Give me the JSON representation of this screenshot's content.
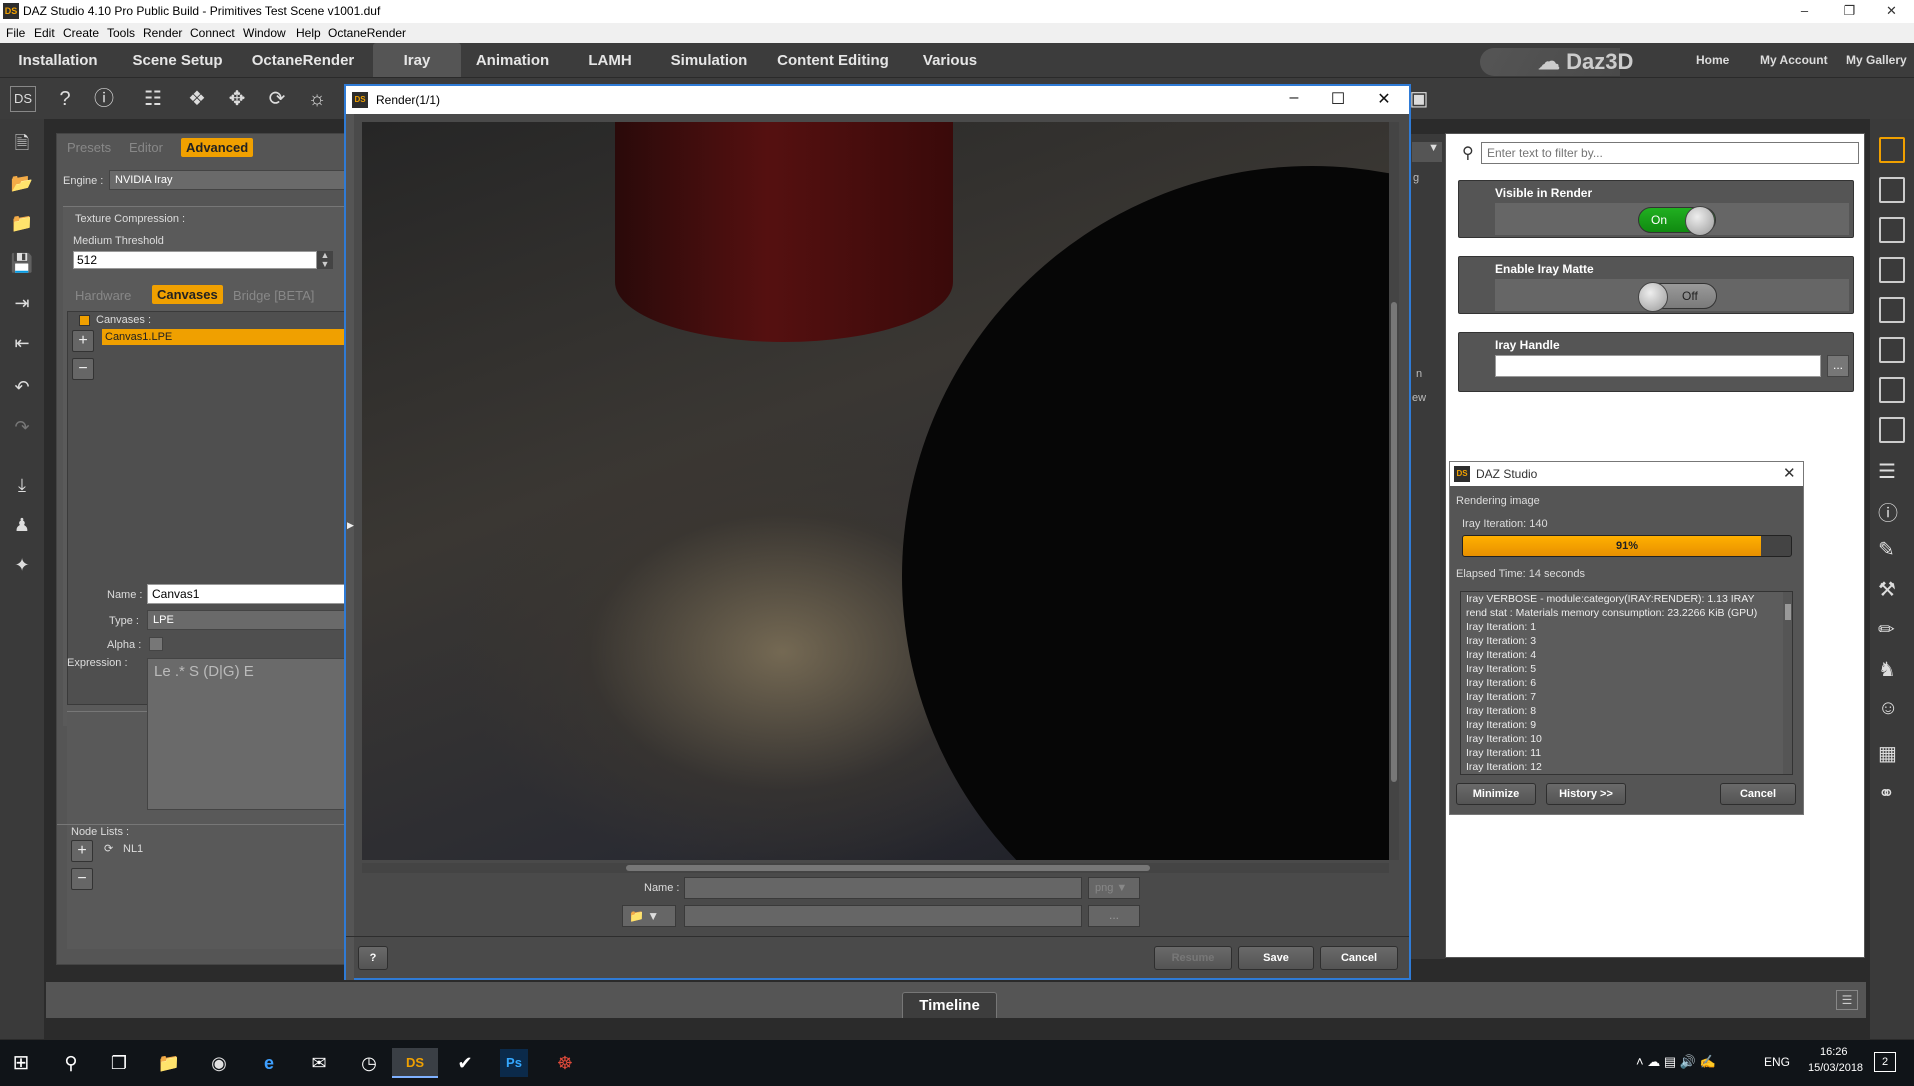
{
  "window": {
    "title": "DAZ Studio 4.10 Pro Public Build - Primitives Test Scene v1001.duf",
    "icon": "DS"
  },
  "menu": [
    "File",
    "Edit",
    "Create",
    "Tools",
    "Render",
    "Connect",
    "Window",
    "Help",
    "OctaneRender"
  ],
  "tabs": [
    "Installation",
    "Scene Setup",
    "OctaneRender",
    "Iray",
    "Animation",
    "LAMH",
    "Simulation",
    "Content Editing",
    "Various"
  ],
  "brand": {
    "name": "Daz3D",
    "links": [
      "Home",
      "My Account",
      "My Gallery"
    ]
  },
  "left_panel": {
    "tabs": [
      "Presets",
      "Editor",
      "Advanced"
    ],
    "engine_label": "Engine :",
    "engine_value": "NVIDIA Iray",
    "texture_compression": "Texture Compression :",
    "medium_threshold_label": "Medium Threshold",
    "medium_threshold_value": "512",
    "sub_tabs": [
      "Hardware",
      "Canvases",
      "Bridge [BETA]"
    ],
    "canvases_label": "Canvases :",
    "canvas_item": "Canvas1.LPE",
    "name_label": "Name :",
    "name_value": "Canvas1",
    "type_label": "Type :",
    "type_value": "LPE",
    "alpha_label": "Alpha :",
    "expression_label": "Expression :",
    "expression_value": "Le .* S (D|G) E",
    "node_lists_label": "Node Lists :",
    "node_list_item": "NL1"
  },
  "render_window": {
    "title": "Render(1/1)",
    "icon": "DS",
    "name_label": "Name :",
    "format_value": "png",
    "browse_label": "...",
    "buttons": {
      "help": "?",
      "resume": "Resume",
      "save": "Save",
      "cancel": "Cancel"
    }
  },
  "right_panel": {
    "search_placeholder": "Enter text to filter by...",
    "visible_in_render": {
      "label": "Visible in Render",
      "state": "On"
    },
    "enable_iray_matte": {
      "label": "Enable Iray Matte",
      "state": "Off"
    },
    "iray_handle": {
      "label": "Iray Handle",
      "button": "..."
    },
    "behind_fragments": [
      "g",
      "n",
      "ew"
    ]
  },
  "daz_dialog": {
    "title": "DAZ Studio",
    "icon": "DS",
    "status": "Rendering image",
    "iteration": "Iray Iteration: 140",
    "progress_percent": 91,
    "progress_label": "91%",
    "elapsed": "Elapsed Time:  14 seconds",
    "log": [
      "Iray VERBOSE - module:category(IRAY:RENDER):   1.13  IRAY",
      "rend stat : Materials memory consumption: 23.2266 KiB (GPU)",
      "Iray Iteration: 1",
      "Iray Iteration: 3",
      "Iray Iteration: 4",
      "Iray Iteration: 5",
      "Iray Iteration: 6",
      "Iray Iteration: 7",
      "Iray Iteration: 8",
      "Iray Iteration: 9",
      "Iray Iteration: 10",
      "Iray Iteration: 11",
      "Iray Iteration: 12"
    ],
    "buttons": {
      "minimize": "Minimize",
      "history": "History >>",
      "cancel": "Cancel"
    }
  },
  "timeline": {
    "label": "Timeline"
  },
  "taskbar": {
    "lang": "ENG",
    "time": "16:26",
    "date": "15/03/2018",
    "active_app": "DS",
    "ps": "Ps",
    "notif": "2"
  }
}
